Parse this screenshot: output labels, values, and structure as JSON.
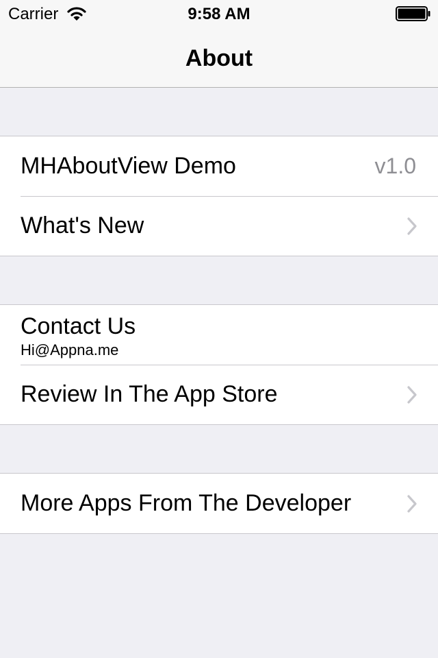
{
  "status_bar": {
    "carrier": "Carrier",
    "time": "9:58 AM",
    "icons": [
      "wifi-icon",
      "battery-icon"
    ]
  },
  "nav": {
    "title": "About"
  },
  "sections": [
    {
      "rows": [
        {
          "title": "MHAboutView Demo",
          "detail": "v1.0"
        },
        {
          "title": "What's New",
          "accessory": "chevron-right-icon"
        }
      ]
    },
    {
      "rows": [
        {
          "title": "Contact Us",
          "subtitle": "Hi@Appna.me"
        },
        {
          "title": "Review In The App Store",
          "accessory": "chevron-right-icon"
        }
      ]
    },
    {
      "rows": [
        {
          "title": "More Apps From The Developer",
          "accessory": "chevron-right-icon"
        }
      ]
    }
  ],
  "colors": {
    "background": "#efeff4",
    "bar": "#f7f7f7",
    "separator": "#c8c7cc",
    "detail_text": "#8e8e93",
    "chevron": "#c7c7cc"
  }
}
